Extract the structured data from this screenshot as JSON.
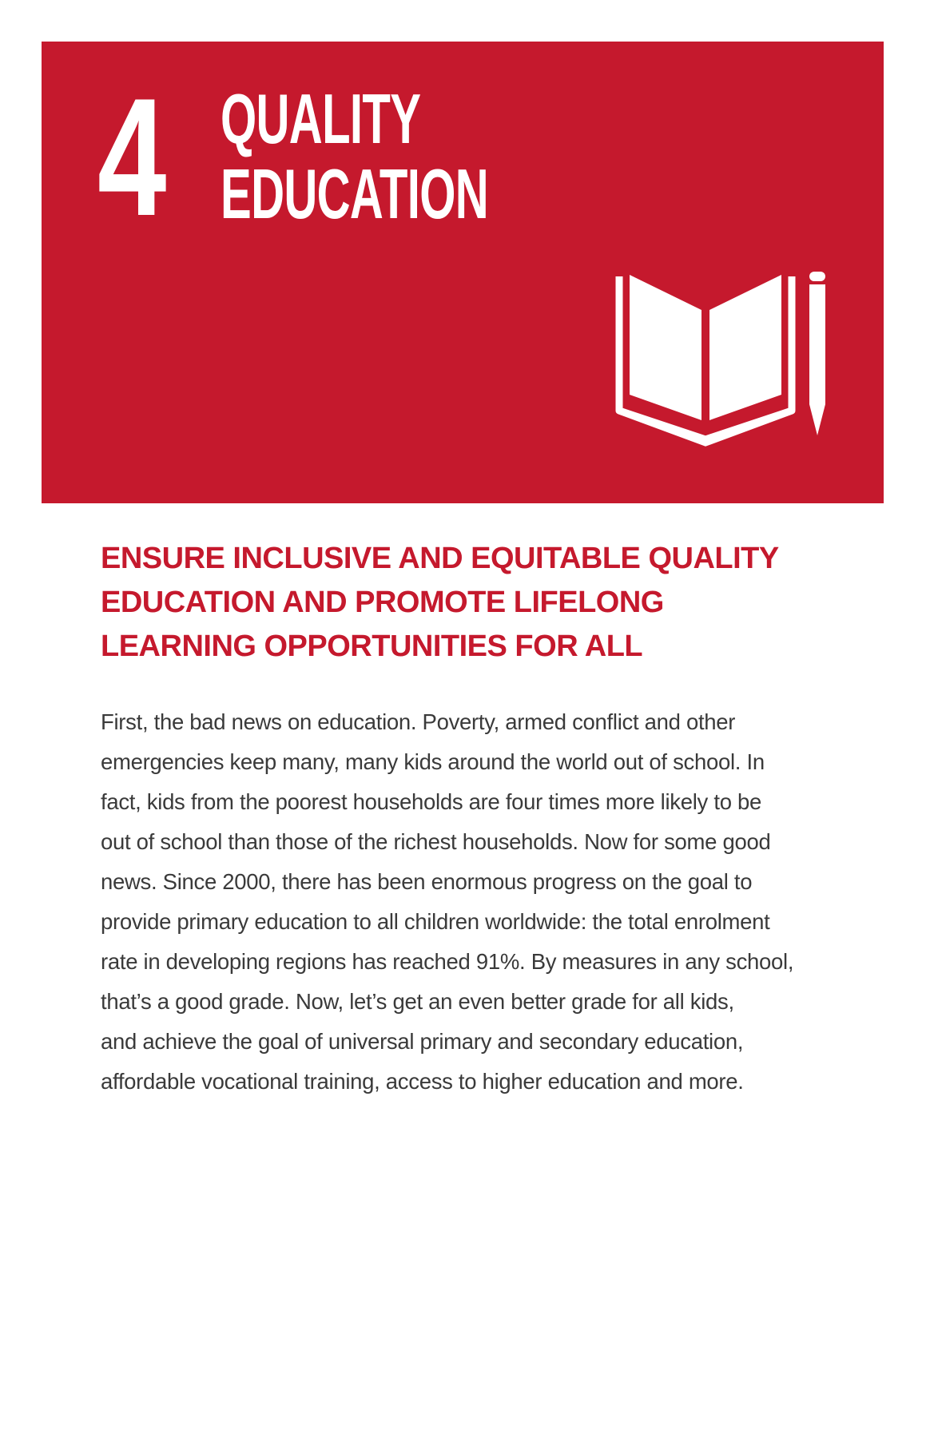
{
  "colors": {
    "goal_red": "#c5192d",
    "text": "#3a3a3a",
    "background": "#ffffff"
  },
  "hero": {
    "number": "4",
    "title_lines": [
      "QUALITY",
      "EDUCATION"
    ],
    "icon": "book-and-pencil-icon"
  },
  "target": {
    "heading_lines": [
      "ENSURE INCLUSIVE AND EQUITABLE QUALITY",
      "EDUCATION AND PROMOTE LIFELONG",
      "LEARNING OPPORTUNITIES FOR ALL"
    ]
  },
  "body": {
    "lines": [
      "First, the bad news on education. Poverty, armed conflict and other",
      "emergencies keep many, many kids around the world out of school. In",
      "fact, kids from the poorest households are four times more likely to be",
      "out of school than those of the richest households. Now for some good",
      "news. Since 2000, there has been enormous progress on the goal to",
      "provide primary education to all children worldwide: the total enrolment",
      "rate in developing regions has reached 91%. By measures in any school,",
      "that’s a good grade. Now, let’s get an even better grade for all kids,",
      "and achieve the goal of universal primary and secondary education,",
      "affordable vocational training, access to higher education and more."
    ]
  }
}
